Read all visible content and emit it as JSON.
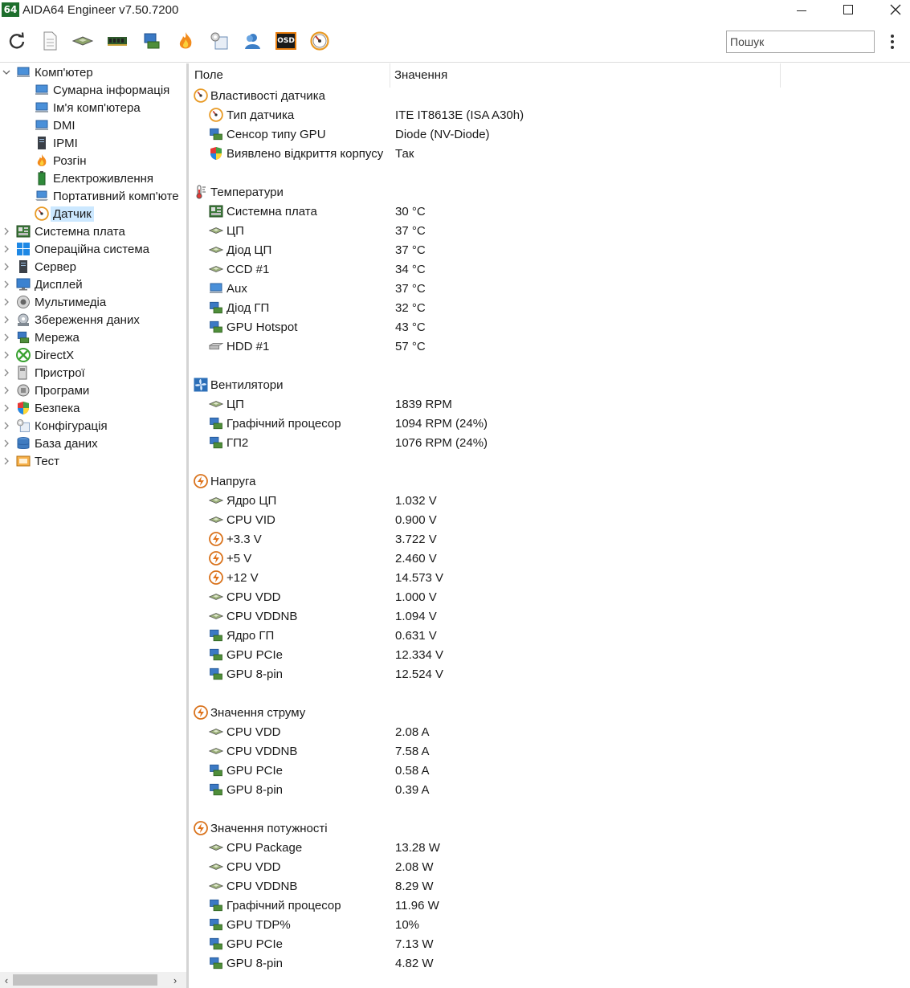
{
  "app": {
    "logo_text": "64",
    "title": "AIDA64 Engineer v7.50.7200"
  },
  "toolbar": {
    "buttons": [
      "refresh-icon",
      "report-icon",
      "cpu-icon",
      "memory-icon",
      "network-icon",
      "flame-icon",
      "settings-icon",
      "user-icon",
      "osd-icon",
      "gauge-icon"
    ],
    "osd_label": "OSD",
    "search_placeholder": "Пошук"
  },
  "tree": {
    "items": [
      {
        "label": "Комп'ютер",
        "icon": "computer-icon",
        "level": 0,
        "arrow": "down"
      },
      {
        "label": "Сумарна інформація",
        "icon": "computer-icon",
        "level": 1
      },
      {
        "label": "Ім'я комп'ютера",
        "icon": "computer-icon",
        "level": 1
      },
      {
        "label": "DMI",
        "icon": "computer-icon",
        "level": 1
      },
      {
        "label": "IPMI",
        "icon": "server-icon",
        "level": 1
      },
      {
        "label": "Розгін",
        "icon": "flame-icon",
        "level": 1
      },
      {
        "label": "Електроживлення",
        "icon": "battery-icon",
        "level": 1
      },
      {
        "label": "Портативний комп'юте",
        "icon": "laptop-icon",
        "level": 1
      },
      {
        "label": "Датчик",
        "icon": "gauge-icon",
        "level": 1,
        "selected": true
      },
      {
        "label": "Системна плата",
        "icon": "motherboard-icon",
        "level": 0,
        "arrow": "right"
      },
      {
        "label": "Операційна система",
        "icon": "windows-icon",
        "level": 0,
        "arrow": "right"
      },
      {
        "label": "Сервер",
        "icon": "server-icon",
        "level": 0,
        "arrow": "right"
      },
      {
        "label": "Дисплей",
        "icon": "monitor-icon",
        "level": 0,
        "arrow": "right"
      },
      {
        "label": "Мультимедіа",
        "icon": "speaker-icon",
        "level": 0,
        "arrow": "right"
      },
      {
        "label": "Збереження даних",
        "icon": "disk-icon",
        "level": 0,
        "arrow": "right"
      },
      {
        "label": "Мережа",
        "icon": "network-icon",
        "level": 0,
        "arrow": "right"
      },
      {
        "label": "DirectX",
        "icon": "xbox-icon",
        "level": 0,
        "arrow": "right"
      },
      {
        "label": "Пристрої",
        "icon": "devices-icon",
        "level": 0,
        "arrow": "right"
      },
      {
        "label": "Програми",
        "icon": "programs-icon",
        "level": 0,
        "arrow": "right"
      },
      {
        "label": "Безпека",
        "icon": "shield-icon",
        "level": 0,
        "arrow": "right"
      },
      {
        "label": "Конфігурація",
        "icon": "config-icon",
        "level": 0,
        "arrow": "right"
      },
      {
        "label": "База даних",
        "icon": "database-icon",
        "level": 0,
        "arrow": "right"
      },
      {
        "label": "Тест",
        "icon": "test-icon",
        "level": 0,
        "arrow": "right"
      }
    ]
  },
  "list": {
    "col_field": "Поле",
    "col_value": "Значення",
    "rows": [
      {
        "type": "group",
        "field": "Властивості датчика",
        "icon": "gauge-icon"
      },
      {
        "type": "item",
        "field": "Тип датчика",
        "value": "ITE IT8613E  (ISA A30h)",
        "icon": "gauge-icon"
      },
      {
        "type": "item",
        "field": "Сенсор типу GPU",
        "value": "Diode  (NV-Diode)",
        "icon": "gpu-icon"
      },
      {
        "type": "item",
        "field": "Виявлено відкриття корпусу",
        "value": "Так",
        "icon": "shield-icon"
      },
      {
        "type": "blank"
      },
      {
        "type": "group",
        "field": "Температури",
        "icon": "thermometer-icon"
      },
      {
        "type": "item",
        "field": "Системна плата",
        "value": "30 °C",
        "icon": "motherboard-icon"
      },
      {
        "type": "item",
        "field": "ЦП",
        "value": "37 °C",
        "icon": "cpu-icon"
      },
      {
        "type": "item",
        "field": "Діод ЦП",
        "value": "37 °C",
        "icon": "cpu-icon"
      },
      {
        "type": "item",
        "field": "CCD #1",
        "value": "34 °C",
        "icon": "cpu-icon"
      },
      {
        "type": "item",
        "field": "Aux",
        "value": "37 °C",
        "icon": "computer-icon"
      },
      {
        "type": "item",
        "field": "Діод ГП",
        "value": "32 °C",
        "icon": "gpu-icon"
      },
      {
        "type": "item",
        "field": "GPU Hotspot",
        "value": "43 °C",
        "icon": "gpu-icon"
      },
      {
        "type": "item",
        "field": "HDD #1",
        "value": "57 °C",
        "icon": "hdd-icon"
      },
      {
        "type": "blank"
      },
      {
        "type": "group",
        "field": "Вентилятори",
        "icon": "fan-icon"
      },
      {
        "type": "item",
        "field": "ЦП",
        "value": "1839 RPM",
        "icon": "cpu-icon"
      },
      {
        "type": "item",
        "field": "Графічний процесор",
        "value": "1094 RPM  (24%)",
        "icon": "gpu-icon"
      },
      {
        "type": "item",
        "field": "ГП2",
        "value": "1076 RPM  (24%)",
        "icon": "gpu-icon"
      },
      {
        "type": "blank"
      },
      {
        "type": "group",
        "field": "Напруга",
        "icon": "voltage-icon"
      },
      {
        "type": "item",
        "field": "Ядро ЦП",
        "value": "1.032 V",
        "icon": "cpu-icon"
      },
      {
        "type": "item",
        "field": "CPU VID",
        "value": "0.900 V",
        "icon": "cpu-icon"
      },
      {
        "type": "item",
        "field": "+3.3 V",
        "value": "3.722 V",
        "icon": "voltage-icon"
      },
      {
        "type": "item",
        "field": "+5 V",
        "value": "2.460 V",
        "icon": "voltage-icon"
      },
      {
        "type": "item",
        "field": "+12 V",
        "value": "14.573 V",
        "icon": "voltage-icon"
      },
      {
        "type": "item",
        "field": "CPU VDD",
        "value": "1.000 V",
        "icon": "cpu-icon"
      },
      {
        "type": "item",
        "field": "CPU VDDNB",
        "value": "1.094 V",
        "icon": "cpu-icon"
      },
      {
        "type": "item",
        "field": "Ядро ГП",
        "value": "0.631 V",
        "icon": "gpu-icon"
      },
      {
        "type": "item",
        "field": "GPU PCIe",
        "value": "12.334 V",
        "icon": "gpu-icon"
      },
      {
        "type": "item",
        "field": "GPU 8-pin",
        "value": "12.524 V",
        "icon": "gpu-icon"
      },
      {
        "type": "blank"
      },
      {
        "type": "group",
        "field": "Значення струму",
        "icon": "voltage-icon"
      },
      {
        "type": "item",
        "field": "CPU VDD",
        "value": "2.08 A",
        "icon": "cpu-icon"
      },
      {
        "type": "item",
        "field": "CPU VDDNB",
        "value": "7.58 A",
        "icon": "cpu-icon"
      },
      {
        "type": "item",
        "field": "GPU PCIe",
        "value": "0.58 A",
        "icon": "gpu-icon"
      },
      {
        "type": "item",
        "field": "GPU 8-pin",
        "value": "0.39 A",
        "icon": "gpu-icon"
      },
      {
        "type": "blank"
      },
      {
        "type": "group",
        "field": "Значення потужності",
        "icon": "voltage-icon"
      },
      {
        "type": "item",
        "field": "CPU Package",
        "value": "13.28 W",
        "icon": "cpu-icon"
      },
      {
        "type": "item",
        "field": "CPU VDD",
        "value": "2.08 W",
        "icon": "cpu-icon"
      },
      {
        "type": "item",
        "field": "CPU VDDNB",
        "value": "8.29 W",
        "icon": "cpu-icon"
      },
      {
        "type": "item",
        "field": "Графічний процесор",
        "value": "11.96 W",
        "icon": "gpu-icon"
      },
      {
        "type": "item",
        "field": "GPU TDP%",
        "value": "10%",
        "icon": "gpu-icon"
      },
      {
        "type": "item",
        "field": "GPU PCIe",
        "value": "7.13 W",
        "icon": "gpu-icon"
      },
      {
        "type": "item",
        "field": "GPU 8-pin",
        "value": "4.82 W",
        "icon": "gpu-icon"
      }
    ]
  },
  "colors": {
    "selection": "#cce8ff",
    "logo_bg": "#1d6e2c"
  }
}
